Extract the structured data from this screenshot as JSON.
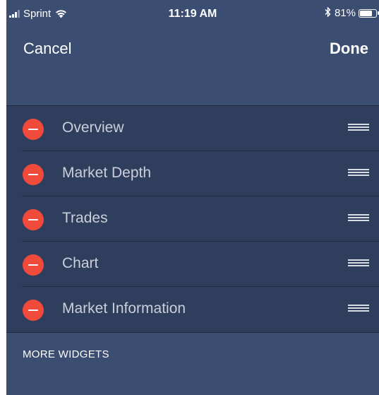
{
  "status_bar": {
    "carrier": "Sprint",
    "time": "11:19 AM",
    "battery_percent_label": "81%",
    "battery_level": 0.81
  },
  "nav": {
    "cancel_label": "Cancel",
    "done_label": "Done"
  },
  "widgets": [
    {
      "label": "Overview"
    },
    {
      "label": "Market Depth"
    },
    {
      "label": "Trades"
    },
    {
      "label": "Chart"
    },
    {
      "label": "Market Information"
    }
  ],
  "section": {
    "more_widgets_label": "MORE WIDGETS"
  },
  "icons": {
    "signal": "signal-bars-icon",
    "wifi": "wifi-icon",
    "bluetooth": "bluetooth-icon",
    "battery": "battery-icon",
    "delete": "minus-circle-icon",
    "reorder": "drag-handle-icon"
  },
  "colors": {
    "background": "#3b4d70",
    "row_background": "#2f3e5c",
    "delete_red": "#f04a3a",
    "separator": "#1f2a3f"
  }
}
